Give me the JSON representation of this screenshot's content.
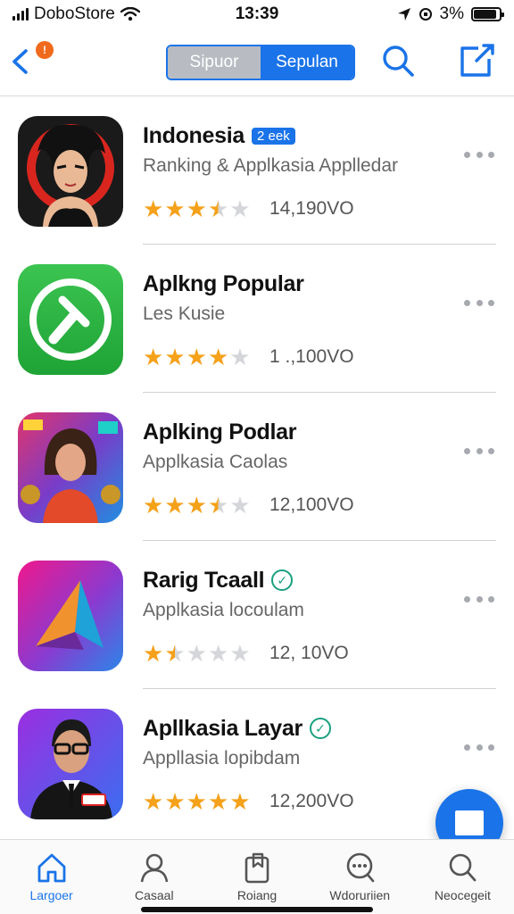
{
  "status_bar": {
    "carrier": "DoboStore",
    "time": "13:39",
    "battery_percent": "3%",
    "battery_level": 0.9,
    "icons": [
      "signal-icon",
      "wifi-icon",
      "location-icon",
      "rotation-lock-icon",
      "battery-icon"
    ]
  },
  "nav": {
    "back_icon": "chevron-left-icon",
    "notification_badge": "!",
    "segments": [
      "Sipuor",
      "Sepulan"
    ],
    "selected_segment": "Sepulan",
    "search_icon": "search-icon",
    "compose_icon": "compose-icon",
    "accent_color": "#1a73e8"
  },
  "apps": [
    {
      "name": "Indonesia",
      "badge": "2 eek",
      "verified": false,
      "subtitle": "Ranking & Applkasia Applledar",
      "rating": 3.5,
      "count": "14,190VO",
      "icon": "anime-girl-icon"
    },
    {
      "name": "Aplkng Popular",
      "badge": "",
      "verified": false,
      "subtitle": "Les Kusie",
      "rating": 4,
      "count": "1 .,100VO",
      "icon": "green-clock-icon"
    },
    {
      "name": "Aplking Podlar",
      "badge": "",
      "verified": false,
      "subtitle": "Applkasia Caolas",
      "rating": 3.5,
      "count": "12,100VO",
      "icon": "game-woman-icon"
    },
    {
      "name": "Rarig Tcaall",
      "badge": "",
      "verified": true,
      "verified_mark": "✓",
      "subtitle": "Applkasia locoulam",
      "rating": 1.5,
      "count": "12, 10VO",
      "icon": "triangle-logo-icon"
    },
    {
      "name": "Apllkasia Layar",
      "badge": "",
      "verified": true,
      "verified_mark": "✓",
      "subtitle": "Appllasia lopibdam",
      "rating": 5,
      "count": "12,200VO",
      "icon": "suited-man-icon"
    }
  ],
  "more_icon": "more-dots-icon",
  "fab_icon": "square-icon",
  "tabs": [
    {
      "label": "Largoer",
      "icon": "home-icon",
      "active": true
    },
    {
      "label": "Casaal",
      "icon": "person-icon",
      "active": false
    },
    {
      "label": "Roiang",
      "icon": "bookmark-icon",
      "active": false
    },
    {
      "label": "Wdoruriien",
      "icon": "chat-icon",
      "active": false
    },
    {
      "label": "Neocegeit",
      "icon": "search-icon",
      "active": false
    }
  ],
  "colors": {
    "star": "#f5a11a",
    "star_empty": "#d4d6da",
    "accent": "#1a73e8"
  }
}
